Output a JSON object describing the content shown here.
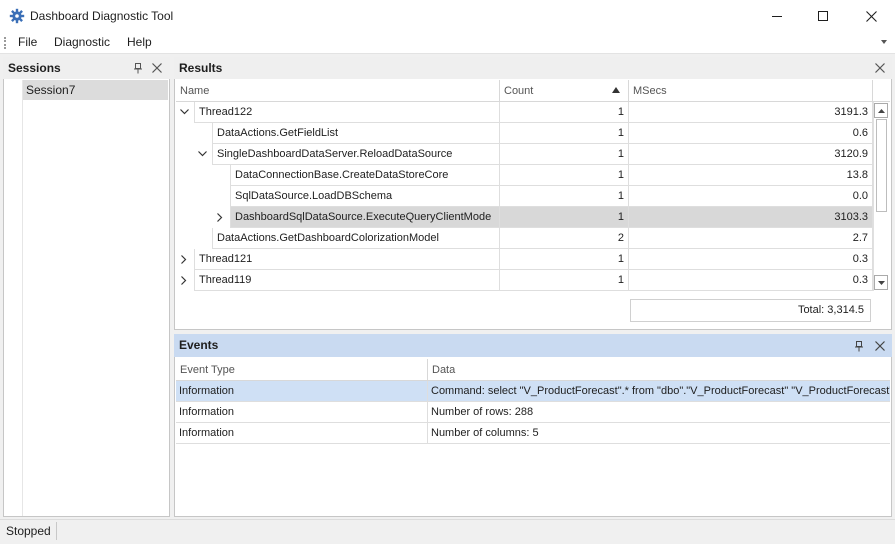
{
  "window": {
    "title": "Dashboard Diagnostic Tool"
  },
  "menu": {
    "items": [
      "File",
      "Diagnostic",
      "Help"
    ]
  },
  "sessions": {
    "title": "Sessions",
    "items": [
      "Session7"
    ],
    "selected": "Session7"
  },
  "results": {
    "title": "Results",
    "columns": {
      "name": "Name",
      "count": "Count",
      "msecs": "MSecs"
    },
    "sort": {
      "column": "Count",
      "direction": "ascending"
    },
    "rows": [
      {
        "name": "Thread122",
        "count": "1",
        "msecs": "3191.3",
        "level": 0,
        "expander": "expanded"
      },
      {
        "name": "DataActions.GetFieldList",
        "count": "1",
        "msecs": "0.6",
        "level": 1,
        "expander": "none"
      },
      {
        "name": "SingleDashboardDataServer.ReloadDataSource",
        "count": "1",
        "msecs": "3120.9",
        "level": 1,
        "expander": "expanded"
      },
      {
        "name": "DataConnectionBase.CreateDataStoreCore",
        "count": "1",
        "msecs": "13.8",
        "level": 2,
        "expander": "none"
      },
      {
        "name": "SqlDataSource.LoadDBSchema",
        "count": "1",
        "msecs": "0.0",
        "level": 2,
        "expander": "none"
      },
      {
        "name": "DashboardSqlDataSource.ExecuteQueryClientMode",
        "count": "1",
        "msecs": "3103.3",
        "level": 2,
        "expander": "collapsed",
        "selected": true
      },
      {
        "name": "DataActions.GetDashboardColorizationModel",
        "count": "2",
        "msecs": "2.7",
        "level": 1,
        "expander": "none"
      },
      {
        "name": "Thread121",
        "count": "1",
        "msecs": "0.3",
        "level": 0,
        "expander": "collapsed"
      },
      {
        "name": "Thread119",
        "count": "1",
        "msecs": "0.3",
        "level": 0,
        "expander": "collapsed"
      }
    ],
    "total": "Total: 3,314.5"
  },
  "events": {
    "title": "Events",
    "columns": {
      "type": "Event Type",
      "data": "Data"
    },
    "rows": [
      {
        "type": "Information",
        "data": "Command: select \"V_ProductForecast\".* from \"dbo\".\"V_ProductForecast\" \"V_ProductForecast\"",
        "selected": true
      },
      {
        "type": "Information",
        "data": "Number of rows: 288"
      },
      {
        "type": "Information",
        "data": "Number of columns: 5"
      }
    ]
  },
  "status": {
    "text": "Stopped"
  },
  "icons": {
    "app": "gear-icon",
    "pin": "pin-icon",
    "close": "close-icon",
    "expanded": "chevron-down-icon",
    "collapsed": "chevron-right-icon",
    "sort": "sort-ascending-icon"
  },
  "colors": {
    "selection": "#d8d8d8",
    "events_header": "#c9daf1",
    "events_selection": "#cfe0f5",
    "app_icon": "#3a6fb7"
  }
}
